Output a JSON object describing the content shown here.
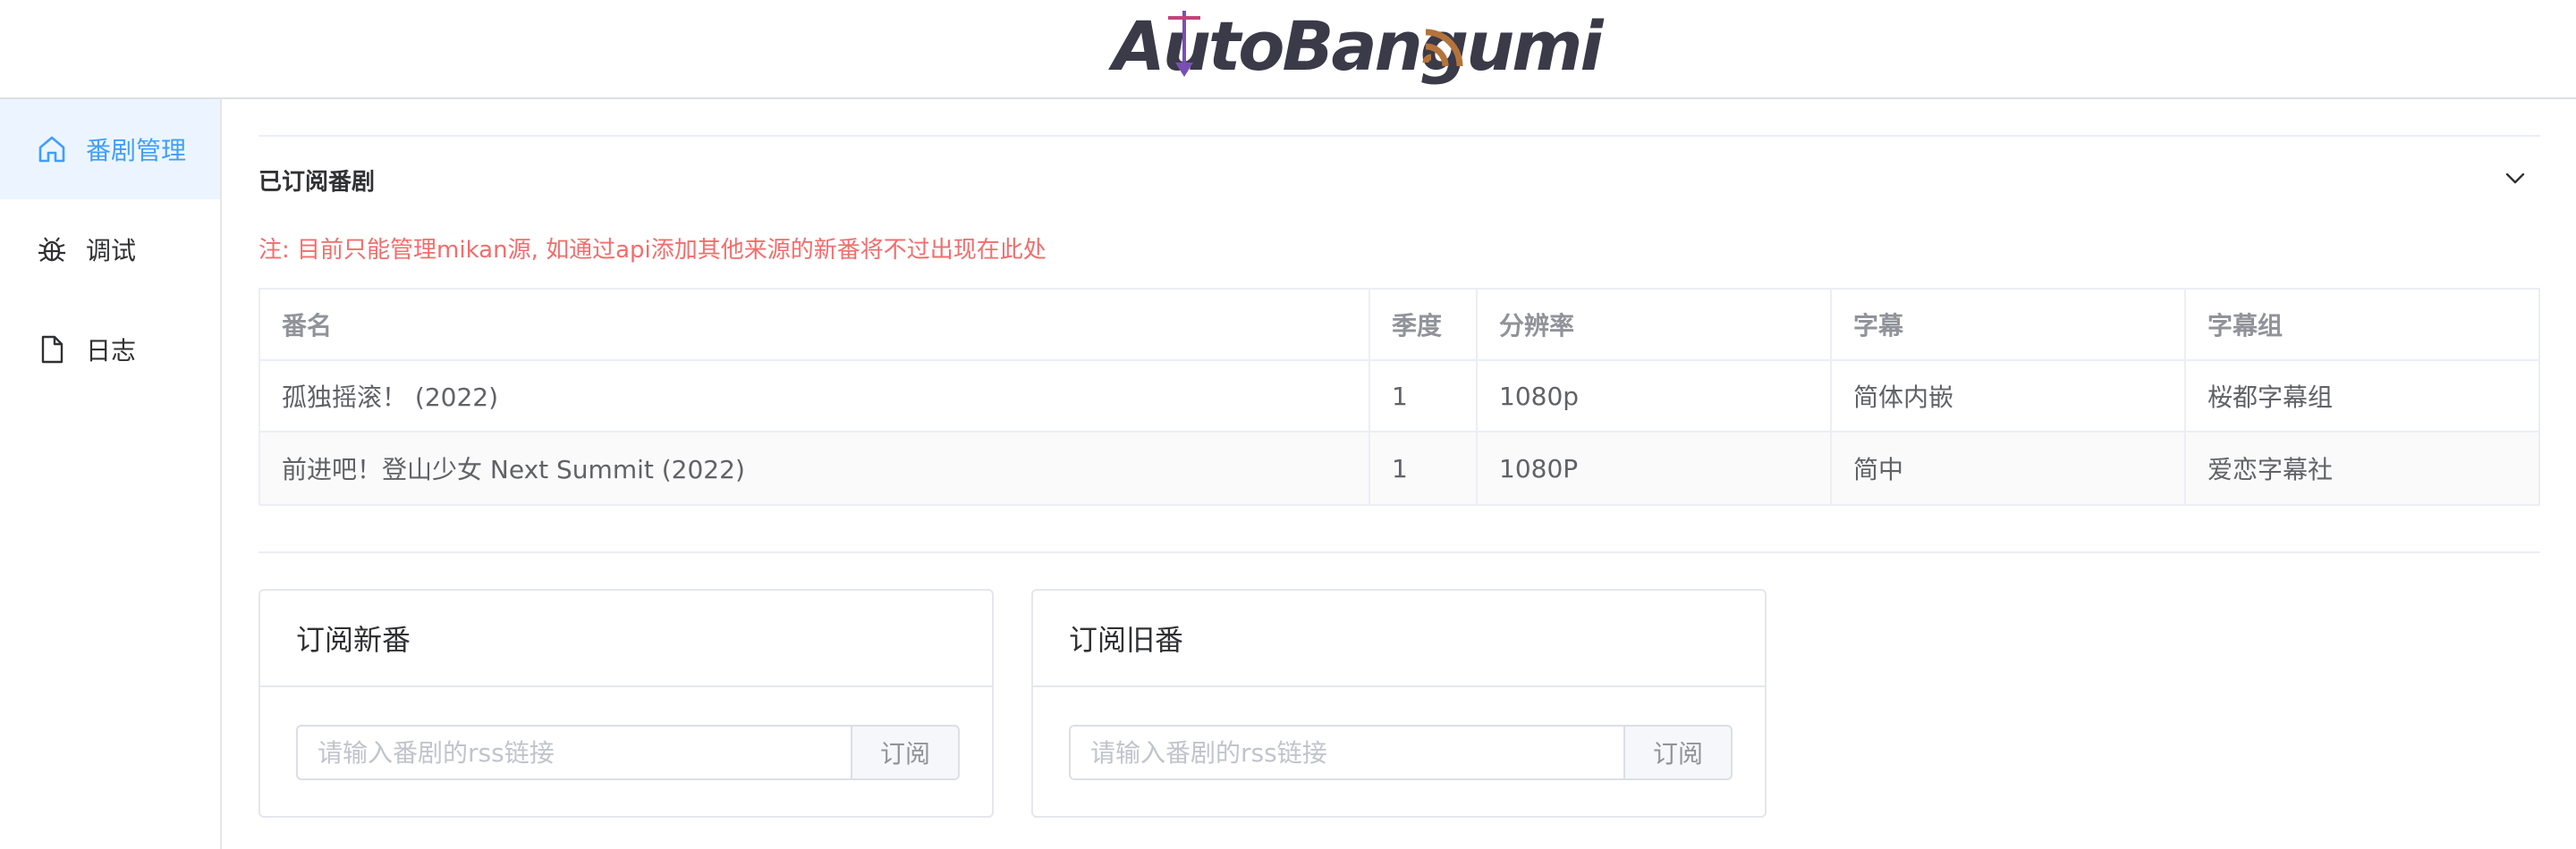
{
  "header": {
    "logo_text": "AutoBangumi"
  },
  "sidebar": {
    "items": [
      {
        "label": "番剧管理",
        "icon": "home-icon",
        "active": true
      },
      {
        "label": "调试",
        "icon": "bug-icon",
        "active": false
      },
      {
        "label": "日志",
        "icon": "document-icon",
        "active": false
      }
    ]
  },
  "main": {
    "section_title": "已订阅番剧",
    "note": "注: 目前只能管理mikan源, 如通过api添加其他来源的新番将不过出现在此处",
    "table": {
      "headers": [
        "番名",
        "季度",
        "分辨率",
        "字幕",
        "字幕组"
      ],
      "rows": [
        [
          "孤独摇滚！ (2022)",
          "1",
          "1080p",
          "简体内嵌",
          "桜都字幕组"
        ],
        [
          "前进吧！登山少女 Next Summit (2022)",
          "1",
          "1080P",
          "简中",
          "爱恋字幕社"
        ]
      ]
    },
    "cards": [
      {
        "title": "订阅新番",
        "placeholder": "请输入番剧的rss链接",
        "button": "订阅"
      },
      {
        "title": "订阅旧番",
        "placeholder": "请输入番剧的rss链接",
        "button": "订阅"
      }
    ]
  },
  "colors": {
    "accent": "#409eff",
    "active_bg": "#ecf5ff",
    "note": "#f56c6c",
    "logo_dark": "#3a3a48",
    "logo_orange": "#b5733b",
    "logo_purple": "#7a4fb5"
  }
}
